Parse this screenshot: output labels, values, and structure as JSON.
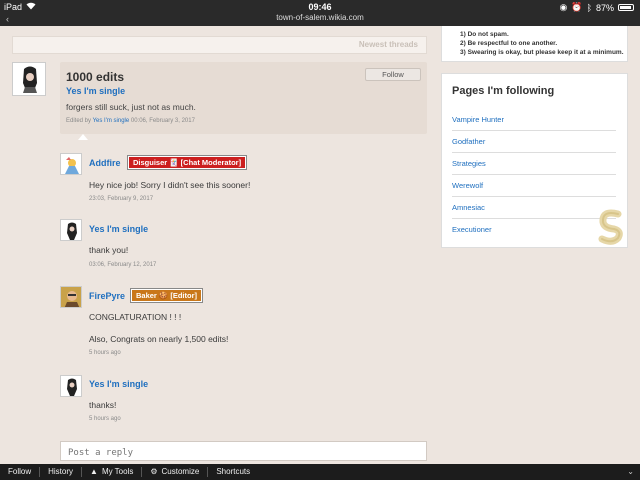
{
  "status_bar": {
    "device": "iPad",
    "time": "09:46",
    "url": "town-of-salem.wikia.com",
    "battery": "87%"
  },
  "thread": {
    "newest_threads": "Newest threads",
    "title": "1000 edits",
    "author": "Yes I'm single",
    "body": "forgers still suck, just not as much.",
    "edited_prefix": "Edited by",
    "edited_by": "Yes I'm single",
    "edited_time": "00:06, February 3, 2017",
    "follow_label": "Follow"
  },
  "replies": [
    {
      "name": "Addfire",
      "badge": "Disguiser 🃏 [Chat Moderator]",
      "text": "Hey nice job! Sorry I didn't see this sooner!",
      "time": "23:03, February 9, 2017"
    },
    {
      "name": "Yes I'm single",
      "text": "thank you!",
      "time": "03:06, February 12, 2017"
    },
    {
      "name": "FirePyre",
      "badge": "Baker 🍪 [Editor]",
      "text": "CONGLATURATION ! ! !",
      "text2": "Also, Congrats on nearly 1,500 edits!",
      "time": "5 hours ago"
    },
    {
      "name": "Yes I'm single",
      "text": "thanks!",
      "time": "5 hours ago"
    }
  ],
  "reply_input": {
    "placeholder": "Post a reply"
  },
  "rules": [
    "1) Do not spam.",
    "2) Be respectful to one another.",
    "3) Swearing is okay, but please keep it at a minimum."
  ],
  "following": {
    "title": "Pages I'm following",
    "items": [
      "Vampire Hunter",
      "Godfather",
      "Strategies",
      "Werewolf",
      "Amnesiac",
      "Executioner"
    ]
  },
  "toolbar": {
    "follow": "Follow",
    "history": "History",
    "my_tools": "My Tools",
    "customize": "Customize",
    "shortcuts": "Shortcuts"
  },
  "colors": {
    "link": "#1f6fbf",
    "moderator_badge": "#cc1f1f",
    "editor_badge": "#c9771a"
  }
}
